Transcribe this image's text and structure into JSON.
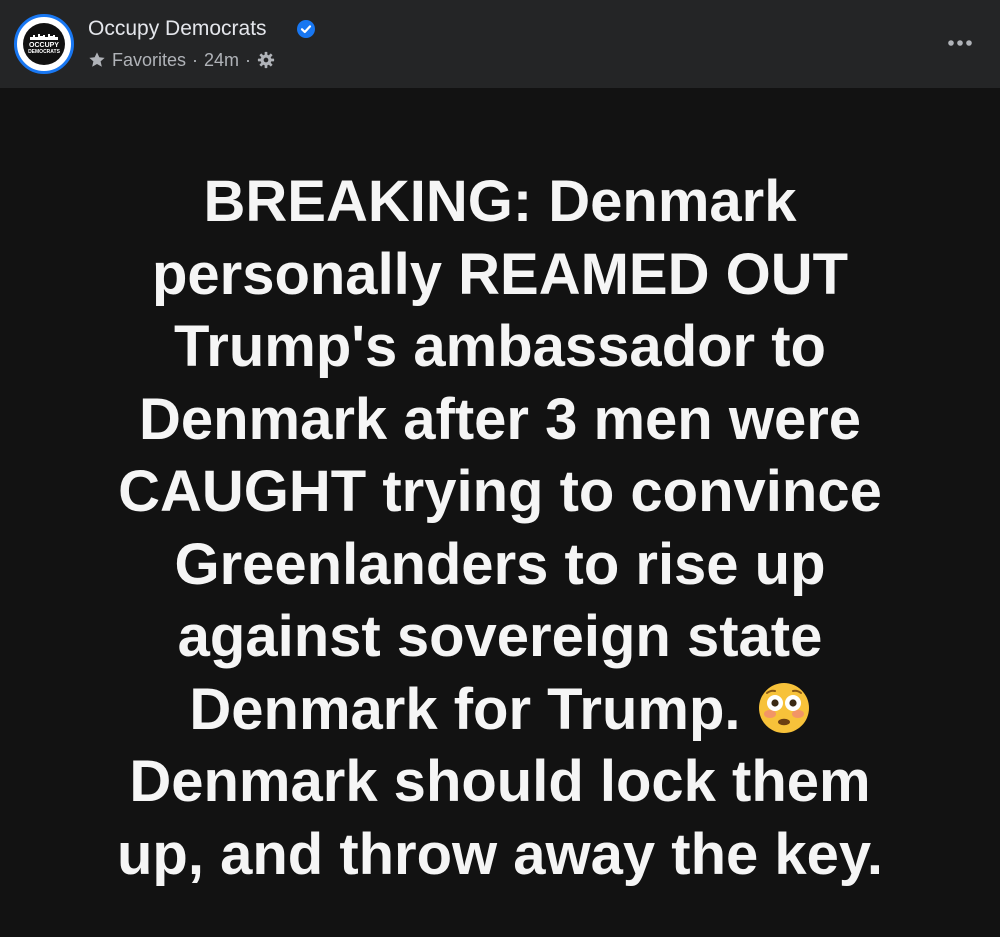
{
  "post": {
    "page_name": "Occupy Democrats",
    "avatar_text_line1": "OCCUPY",
    "avatar_text_line2": "DEMOCRATS",
    "audience": "Favorites",
    "separator": "·",
    "time": "24m",
    "icons": {
      "verified": "verified-badge-icon",
      "favorites": "star-icon",
      "audience": "gear-icon",
      "more": "more-options-icon"
    },
    "colors": {
      "header_bg": "#242526",
      "content_bg": "#121212",
      "verified_blue": "#1877f2",
      "name_text": "#e4e6eb",
      "meta_text": "#b0b3b8"
    },
    "body_lines": [
      "BREAKING: Denmark",
      "personally REAMED OUT",
      "Trump's ambassador to",
      "Denmark after 3 men were",
      "CAUGHT trying to convince",
      "Greenlanders to rise up",
      "against sovereign state",
      "Denmark for Trump.",
      "Denmark should lock them",
      "up, and throw away the key."
    ],
    "emoji": "flushed-face-emoji"
  }
}
